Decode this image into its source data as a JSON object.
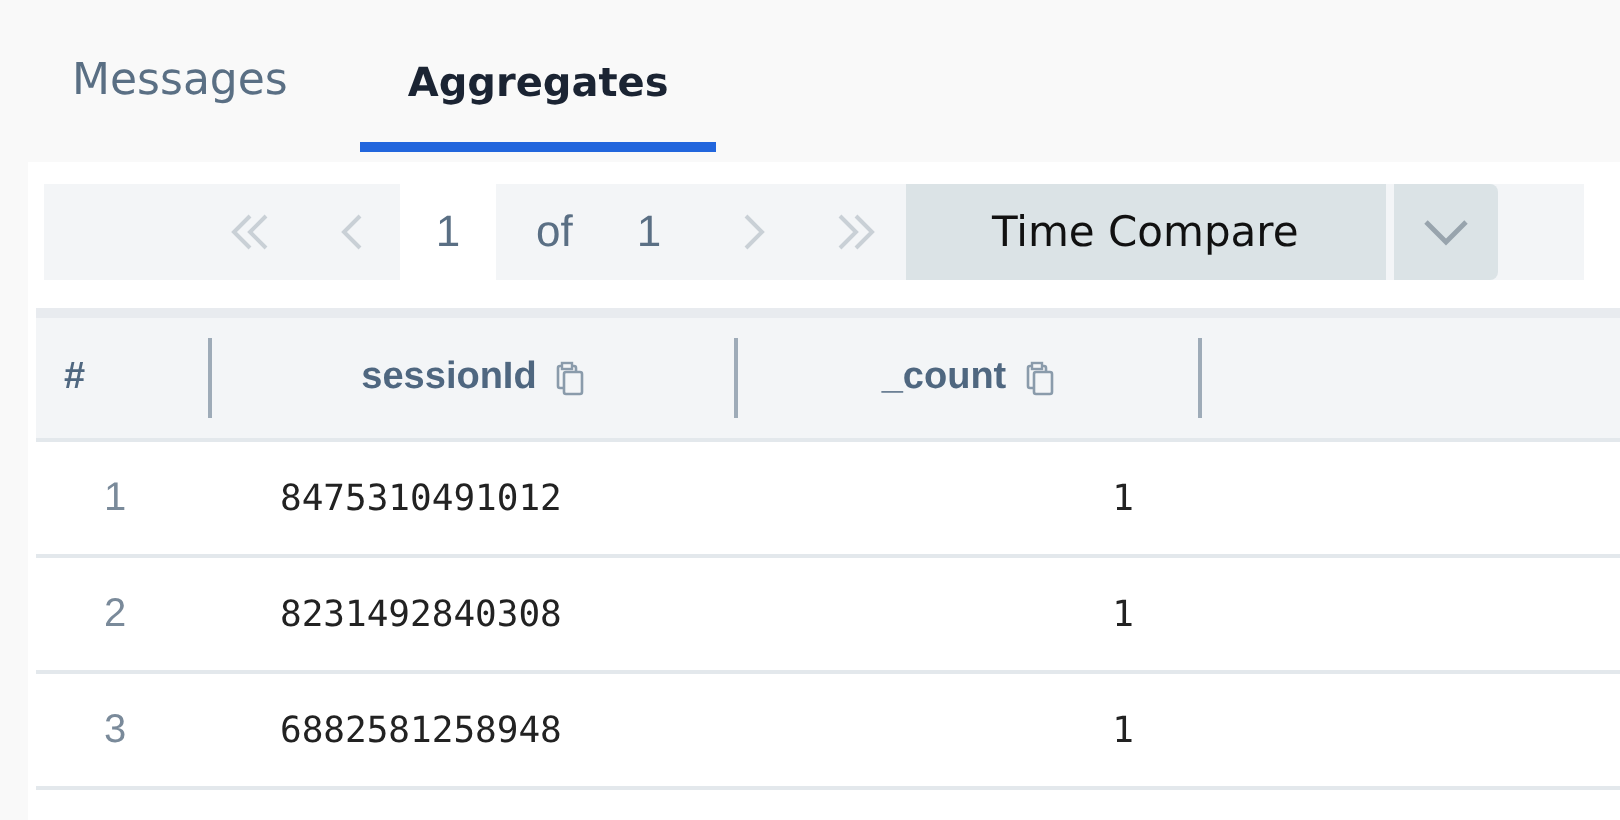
{
  "tabs": [
    {
      "label": "Messages",
      "selected": false
    },
    {
      "label": "Aggregates",
      "selected": true
    }
  ],
  "pager": {
    "page": "1",
    "of": "of",
    "total": "1",
    "first_disabled": true,
    "prev_disabled": true,
    "next_disabled": true,
    "last_disabled": true
  },
  "time_compare": {
    "label": "Time Compare"
  },
  "table": {
    "columns": [
      {
        "label": "#",
        "copy": false
      },
      {
        "label": "sessionId",
        "copy": true
      },
      {
        "label": "_count",
        "copy": true
      }
    ],
    "rows": [
      [
        "1",
        "8475310491012",
        "1"
      ],
      [
        "2",
        "8231492840308",
        "1"
      ],
      [
        "3",
        "6882581258948",
        "1"
      ]
    ]
  }
}
